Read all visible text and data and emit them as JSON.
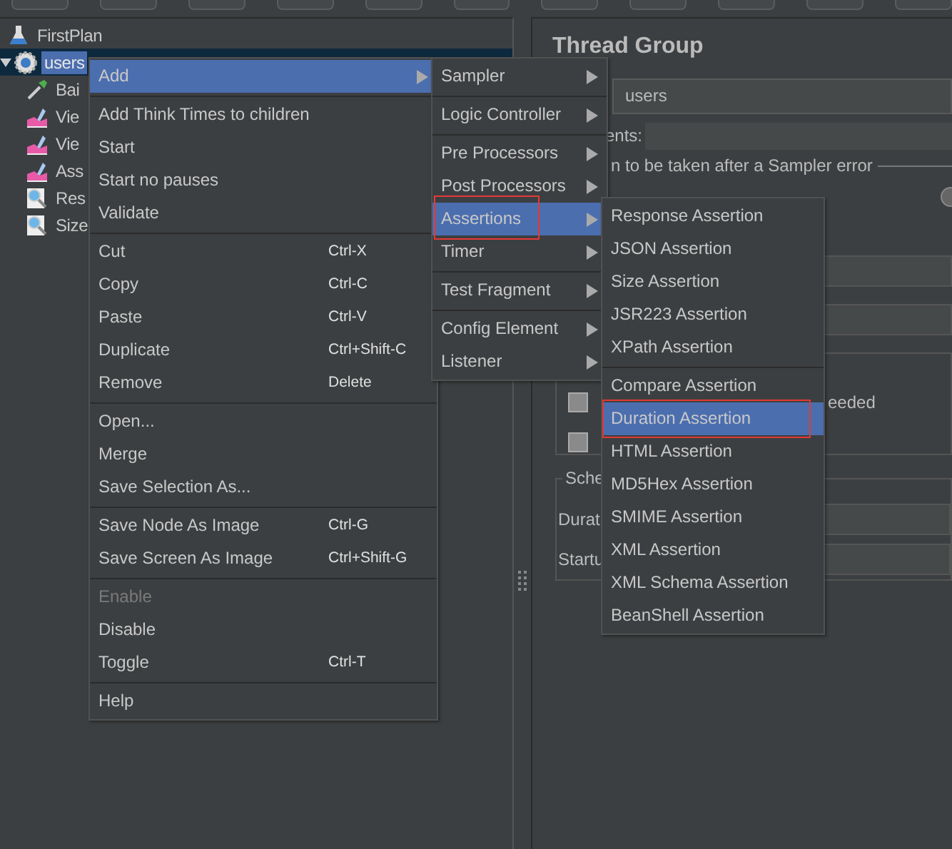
{
  "tree": [
    {
      "label": "FirstPlan",
      "kind": "plan",
      "selected": false,
      "children": [
        {
          "label": "users",
          "kind": "thread-group",
          "selected": true,
          "expanded": true,
          "children": [
            {
              "label": "Bai",
              "kind": "sampler",
              "selected": false
            },
            {
              "label": "Vie",
              "kind": "listener",
              "selected": false
            },
            {
              "label": "Vie",
              "kind": "listener",
              "selected": false
            },
            {
              "label": "Ass",
              "kind": "listener",
              "selected": false
            },
            {
              "label": "Res",
              "kind": "assertion",
              "selected": false
            },
            {
              "label": "Size",
              "kind": "assertion",
              "selected": false
            }
          ]
        }
      ]
    }
  ],
  "thread_group": {
    "title": "Thread Group",
    "name_field": {
      "value": "users"
    },
    "comments_label": "ents:",
    "error_action_label": "n to be taken after a Sampler error",
    "radio_button": {
      "selected": false
    },
    "checkboxes": [
      {
        "label": "eeded",
        "checked": false
      },
      {
        "checked": false
      }
    ],
    "scheduler": {
      "legend": "Sche",
      "duration_label": "Durat",
      "startup_label": "Startu"
    }
  },
  "context_menu": {
    "groups": [
      [
        {
          "label": "Add",
          "submenu": true,
          "selected": true,
          "disabled": false
        }
      ],
      [
        {
          "label": "Add Think Times to children",
          "selected": false,
          "disabled": false
        },
        {
          "label": "Start",
          "selected": false,
          "disabled": false
        },
        {
          "label": "Start no pauses",
          "selected": false,
          "disabled": false
        },
        {
          "label": "Validate",
          "selected": false,
          "disabled": false
        }
      ],
      [
        {
          "label": "Cut",
          "shortcut": "Ctrl-X",
          "selected": false,
          "disabled": false
        },
        {
          "label": "Copy",
          "shortcut": "Ctrl-C",
          "selected": false,
          "disabled": false
        },
        {
          "label": "Paste",
          "shortcut": "Ctrl-V",
          "selected": false,
          "disabled": false
        },
        {
          "label": "Duplicate",
          "shortcut": "Ctrl+Shift-C",
          "selected": false,
          "disabled": false
        },
        {
          "label": "Remove",
          "shortcut": "Delete",
          "selected": false,
          "disabled": false
        }
      ],
      [
        {
          "label": "Open...",
          "selected": false,
          "disabled": false
        },
        {
          "label": "Merge",
          "selected": false,
          "disabled": false
        },
        {
          "label": "Save Selection As...",
          "selected": false,
          "disabled": false
        }
      ],
      [
        {
          "label": "Save Node As Image",
          "shortcut": "Ctrl-G",
          "selected": false,
          "disabled": false
        },
        {
          "label": "Save Screen As Image",
          "shortcut": "Ctrl+Shift-G",
          "selected": false,
          "disabled": false
        }
      ],
      [
        {
          "label": "Enable",
          "selected": false,
          "disabled": true
        },
        {
          "label": "Disable",
          "selected": false,
          "disabled": false
        },
        {
          "label": "Toggle",
          "shortcut": "Ctrl-T",
          "selected": false,
          "disabled": false
        }
      ],
      [
        {
          "label": "Help",
          "selected": false,
          "disabled": false
        }
      ]
    ]
  },
  "add_submenu": {
    "groups": [
      [
        {
          "label": "Sampler",
          "submenu": true,
          "selected": false,
          "outlined": false
        }
      ],
      [
        {
          "label": "Logic Controller",
          "submenu": true,
          "selected": false,
          "outlined": false
        }
      ],
      [
        {
          "label": "Pre Processors",
          "submenu": true,
          "selected": false,
          "outlined": false
        },
        {
          "label": "Post Processors",
          "submenu": true,
          "selected": false,
          "outlined": false
        },
        {
          "label": "Assertions",
          "submenu": true,
          "selected": true,
          "outlined": true
        },
        {
          "label": "Timer",
          "submenu": true,
          "selected": false,
          "outlined": false
        }
      ],
      [
        {
          "label": "Test Fragment",
          "submenu": true,
          "selected": false,
          "outlined": false
        }
      ],
      [
        {
          "label": "Config Element",
          "submenu": true,
          "selected": false,
          "outlined": false
        },
        {
          "label": "Listener",
          "submenu": true,
          "selected": false,
          "outlined": false
        }
      ]
    ]
  },
  "assertions_submenu": {
    "groups": [
      [
        {
          "label": "Response Assertion",
          "selected": false,
          "outlined": false
        },
        {
          "label": "JSON Assertion",
          "selected": false,
          "outlined": false
        },
        {
          "label": "Size Assertion",
          "selected": false,
          "outlined": false
        },
        {
          "label": "JSR223 Assertion",
          "selected": false,
          "outlined": false
        },
        {
          "label": "XPath Assertion",
          "selected": false,
          "outlined": false
        }
      ],
      [
        {
          "label": "Compare Assertion",
          "selected": false,
          "outlined": false
        },
        {
          "label": "Duration Assertion",
          "selected": true,
          "outlined": true
        },
        {
          "label": "HTML Assertion",
          "selected": false,
          "outlined": false
        },
        {
          "label": "MD5Hex Assertion",
          "selected": false,
          "outlined": false
        },
        {
          "label": "SMIME Assertion",
          "selected": false,
          "outlined": false
        },
        {
          "label": "XML Assertion",
          "selected": false,
          "outlined": false
        },
        {
          "label": "XML Schema Assertion",
          "selected": false,
          "outlined": false
        },
        {
          "label": "BeanShell Assertion",
          "selected": false,
          "outlined": false
        }
      ]
    ]
  }
}
